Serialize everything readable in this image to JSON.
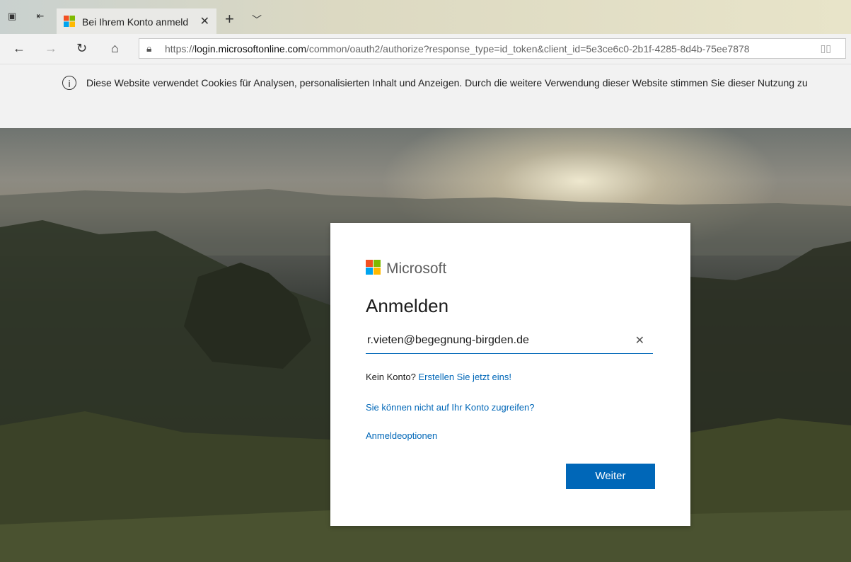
{
  "browser": {
    "tab_title": "Bei Ihrem Konto anmeldc",
    "url_prefix": "https://",
    "url_host": "login.microsoftonline.com",
    "url_path": "/common/oauth2/authorize?response_type=id_token&client_id=5e3ce6c0-2b1f-4285-8d4b-75ee7878"
  },
  "cookie_banner": {
    "message": "Diese Website verwendet Cookies für Analysen, personalisierten Inhalt und Anzeigen. Durch die weitere Verwendung dieser Website stimmen Sie dieser Nutzung zu"
  },
  "signin": {
    "brand": "Microsoft",
    "heading": "Anmelden",
    "email_value": "r.vieten@begegnung-birgden.de",
    "no_account_text": "Kein Konto?",
    "create_link": "Erstellen Sie jetzt eins!",
    "cant_access_link": "Sie können nicht auf Ihr Konto zugreifen?",
    "options_link": "Anmeldeoptionen",
    "next_button": "Weiter"
  },
  "colors": {
    "accent": "#0067b8",
    "ms_red": "#f25022",
    "ms_green": "#7fba00",
    "ms_blue": "#00a4ef",
    "ms_yellow": "#ffb900"
  }
}
